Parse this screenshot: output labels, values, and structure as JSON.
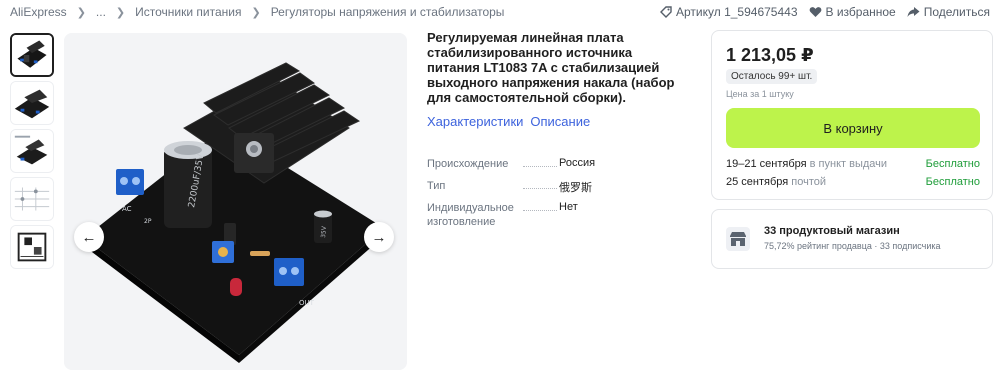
{
  "breadcrumb": {
    "items": [
      "AliExpress",
      "...",
      "Источники питания",
      "Регуляторы напряжения и стабилизаторы"
    ]
  },
  "top_actions": {
    "article": "Артикул 1_594675443",
    "favorite": "В избранное",
    "share": "Поделиться"
  },
  "gallery": {
    "thumbnails": [
      "product-photo-1",
      "product-photo-2",
      "product-photo-3",
      "schematic",
      "pcb-layout"
    ],
    "active_index": 0,
    "board_labels": {
      "ripple": "2200uF/35V",
      "cap_small": "35V",
      "input_terminal": "2P",
      "mark_ac": "AC",
      "mark_out": "OUT"
    }
  },
  "product": {
    "title": "Регулируемая линейная плата стабилизированного источника питания LT1083 7A с стабилизацией выходного напряжения накала (набор для самостоятельной сборки).",
    "tabs": [
      "Характеристики",
      "Описание"
    ],
    "specs": [
      {
        "key": "Происхождение",
        "value": "Россия"
      },
      {
        "key": "Тип",
        "value": "俄罗斯"
      },
      {
        "key": "Индивидуальное изготовление",
        "value": "Нет"
      }
    ]
  },
  "buy_box": {
    "price": "1 213,05 ₽",
    "stock": "Осталось 99+ шт.",
    "unit_note": "Цена за 1 штуку",
    "cart_button": "В корзину",
    "delivery": [
      {
        "date": "19–21 сентября",
        "method": "в пункт выдачи",
        "cost": "Бесплатно"
      },
      {
        "date": "25 сентября",
        "method": "почтой",
        "cost": "Бесплатно"
      }
    ]
  },
  "store": {
    "name": "33 продуктовый магазин",
    "rating": "75,72% рейтинг продавца",
    "separator": "·",
    "subscribers": "33 подписчика"
  },
  "colors": {
    "link": "#3d63dd",
    "cart_button": "#bdf34b",
    "free": "#1f9d3a",
    "muted": "#6b7480"
  }
}
